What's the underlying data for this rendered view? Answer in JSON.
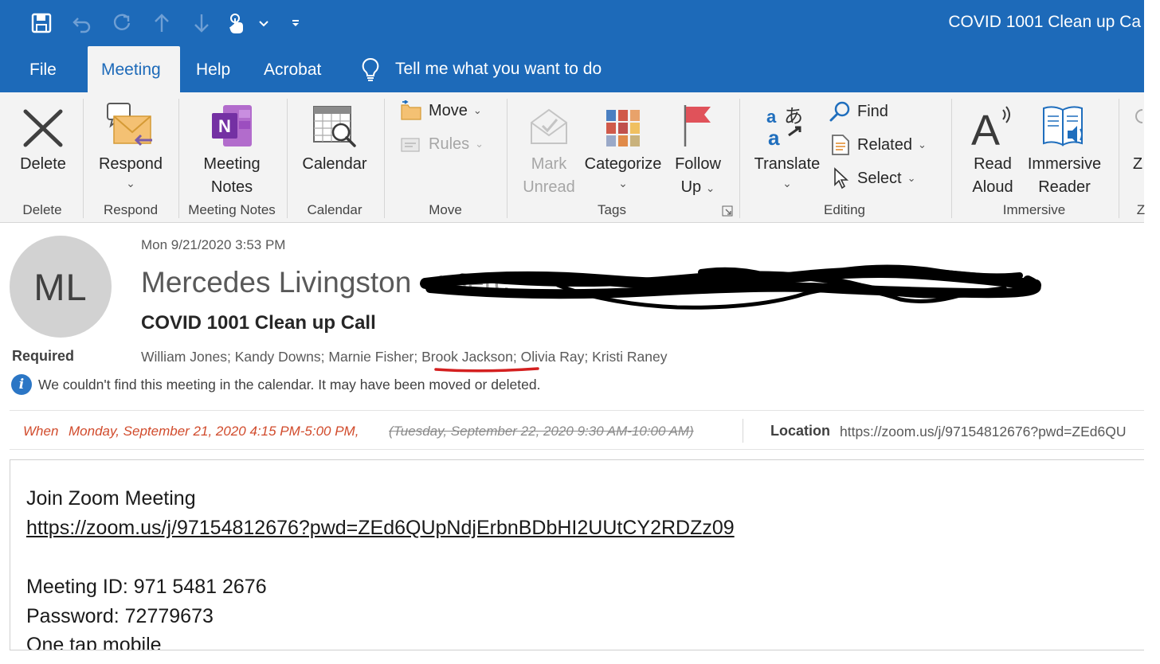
{
  "window": {
    "title": "COVID 1001 Clean up Ca"
  },
  "quick_access": [
    "save-icon",
    "undo-icon",
    "redo-icon",
    "up-arrow-icon",
    "down-arrow-icon",
    "touch-mode-icon",
    "chevron-down-icon",
    "customize-icon"
  ],
  "tabs": {
    "file": "File",
    "meeting": "Meeting",
    "help": "Help",
    "acrobat": "Acrobat",
    "tell_me": "Tell me what you want to do"
  },
  "ribbon": {
    "delete": {
      "button": "Delete",
      "group": "Delete"
    },
    "respond": {
      "button": "Respond",
      "group": "Respond"
    },
    "meeting_notes": {
      "button_line1": "Meeting",
      "button_line2": "Notes",
      "group": "Meeting Notes"
    },
    "calendar": {
      "button": "Calendar",
      "group": "Calendar"
    },
    "move": {
      "move": "Move",
      "rules": "Rules",
      "group": "Move"
    },
    "tags": {
      "mark_line1": "Mark",
      "mark_line2": "Unread",
      "categorize": "Categorize",
      "follow_line1": "Follow",
      "follow_line2": "Up",
      "group": "Tags"
    },
    "editing": {
      "translate": "Translate",
      "find": "Find",
      "related": "Related",
      "select": "Select",
      "group": "Editing"
    },
    "immersive": {
      "read_line1": "Read",
      "read_line2": "Aloud",
      "reader_line1": "Immersive",
      "reader_line2": "Reader",
      "group": "Immersive"
    },
    "zoom_partial": {
      "button": "Z",
      "group": "Z"
    }
  },
  "message": {
    "avatar_initials": "ML",
    "date": "Mon 9/21/2020 3:53 PM",
    "sender": "Mercedes Livingston",
    "sender_email_partial": "<merc",
    "subject": "COVID 1001 Clean up Call",
    "required_label": "Required",
    "attendees": [
      "William Jones;",
      "Kandy Downs;",
      "Marnie Fisher;",
      "Brook Jackson;",
      "Olivia Ray;",
      "Kristi Raney"
    ],
    "info_text": "We couldn't find this meeting in the calendar. It may have been moved or deleted.",
    "when_label": "When",
    "when_value": "Monday, September 21, 2020 4:15 PM-5:00 PM,",
    "when_old": "(Tuesday, September 22, 2020 9:30 AM-10:00 AM)",
    "location_label": "Location",
    "location_value": "https://zoom.us/j/97154812676?pwd=ZEd6QU"
  },
  "body": {
    "join_text": "Join Zoom Meeting",
    "link": "https://zoom.us/j/97154812676?pwd=ZEd6QUpNdjErbnBDbHI2UUtCY2RDZz09",
    "meeting_id": "Meeting ID: 971 5481 2676",
    "password": "Password: 72779673",
    "cut_line": "One tap mobile"
  },
  "colors": {
    "brand_blue": "#1d6ab9",
    "ribbon_bg": "#f3f3f3",
    "when_red": "#d14b2c",
    "link_blue": "#1a6ac2",
    "annotation_red": "#d42020"
  }
}
